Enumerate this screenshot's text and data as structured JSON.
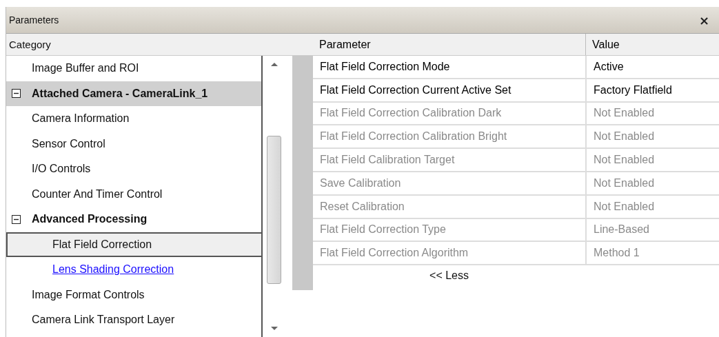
{
  "window": {
    "title": "Parameters",
    "close": "×"
  },
  "category_header": "Category",
  "tree": [
    {
      "label": "Image Buffer and ROI",
      "kind": "item",
      "selected": false
    },
    {
      "label": "Attached Camera - CameraLink_1",
      "kind": "category",
      "expanded": true,
      "children": [
        {
          "label": "Camera Information",
          "kind": "item",
          "selected": false
        },
        {
          "label": "Sensor Control",
          "kind": "item",
          "selected": false
        },
        {
          "label": "I/O Controls",
          "kind": "item",
          "selected": false
        },
        {
          "label": "Counter And Timer Control",
          "kind": "item",
          "selected": false
        },
        {
          "label": "Advanced Processing",
          "kind": "group",
          "expanded": true,
          "children": [
            {
              "label": "Flat Field Correction",
              "kind": "item",
              "selected": true
            },
            {
              "label": "Lens Shading Correction",
              "kind": "link",
              "selected": false
            }
          ]
        },
        {
          "label": "Image Format Controls",
          "kind": "item",
          "selected": false
        },
        {
          "label": "Camera Link Transport Layer",
          "kind": "item",
          "selected": false
        }
      ]
    }
  ],
  "table": {
    "columns": [
      "Parameter",
      "Value"
    ],
    "rows": [
      {
        "parameter": "Flat Field Correction Mode",
        "value": "Active",
        "enabled": true
      },
      {
        "parameter": "Flat Field Correction Current Active Set",
        "value": "Factory Flatfield",
        "enabled": true
      },
      {
        "parameter": "Flat Field Correction Calibration Dark",
        "value": "Not Enabled",
        "enabled": false
      },
      {
        "parameter": "Flat Field Correction Calibration Bright",
        "value": "Not Enabled",
        "enabled": false
      },
      {
        "parameter": "Flat Field Calibration Target",
        "value": "Not Enabled",
        "enabled": false
      },
      {
        "parameter": "Save Calibration",
        "value": "Not Enabled",
        "enabled": false
      },
      {
        "parameter": "Reset Calibration",
        "value": "Not Enabled",
        "enabled": false
      },
      {
        "parameter": "Flat Field Correction Type",
        "value": "Line-Based",
        "enabled": false
      },
      {
        "parameter": "Flat Field Correction Algorithm",
        "value": "Method 1",
        "enabled": false
      }
    ],
    "toggle": "<< Less"
  }
}
